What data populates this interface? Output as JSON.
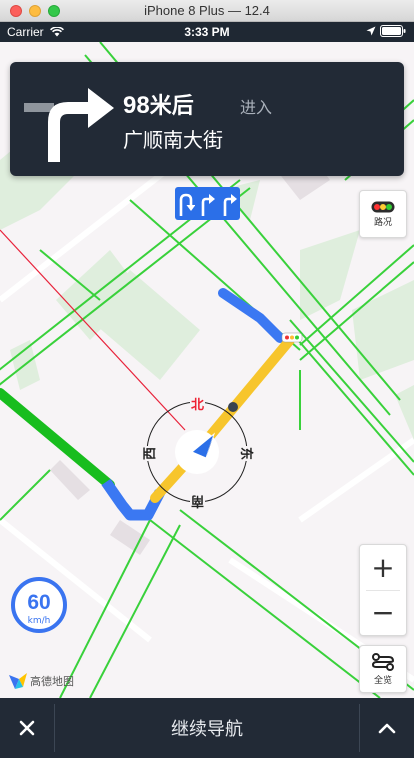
{
  "window": {
    "title": "iPhone 8 Plus — 12.4"
  },
  "statusbar": {
    "carrier": "Carrier",
    "time": "3:33 PM"
  },
  "guide": {
    "distance_value": "98",
    "distance_unit": "米后",
    "action": "进入",
    "road": "广顺南大街",
    "turn_icon": "turn-right-arrow"
  },
  "lanes": {
    "icons": [
      "u-turn-lane",
      "right-turn-lane",
      "right-turn-lane"
    ]
  },
  "traffic_button": {
    "label": "路况"
  },
  "compass": {
    "north": "北",
    "east": "东",
    "south": "南",
    "west": "西"
  },
  "zoom": {
    "in_label": "+",
    "out_label": "−"
  },
  "overview_button": {
    "label": "全览"
  },
  "speed_limit": {
    "value": "60",
    "unit": "km/h"
  },
  "logo": {
    "text": "高德地图"
  },
  "bottom": {
    "continue_label": "继续导航"
  },
  "colors": {
    "route_blue": "#3b78f2",
    "route_yellow": "#f7c52c",
    "road_green": "#39d13b",
    "panel_dark": "#222a36"
  }
}
